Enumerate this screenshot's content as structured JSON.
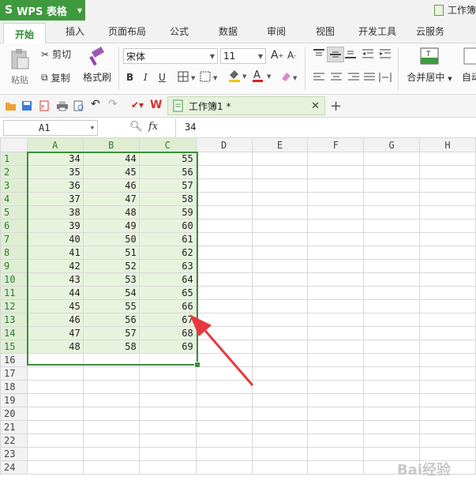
{
  "app": {
    "logo_letter": "S",
    "name": "WPS 表格",
    "doc_title": "工作簿"
  },
  "tabs": [
    "开始",
    "插入",
    "页面布局",
    "公式",
    "数据",
    "审阅",
    "视图",
    "开发工具",
    "云服务"
  ],
  "ribbon": {
    "paste": "粘贴",
    "cut": "剪切",
    "copy": "复制",
    "format_painter": "格式刷",
    "font_name": "宋体",
    "font_size": "11",
    "merge_center": "合并居中",
    "auto_wrap": "自动"
  },
  "document_tab": {
    "name": "工作簿1 *"
  },
  "formula_bar": {
    "cell_ref": "A1",
    "fx": "fx",
    "value": "34"
  },
  "sheet": {
    "columns": [
      "A",
      "B",
      "C",
      "D",
      "E",
      "F",
      "G",
      "H"
    ],
    "rows": [
      {
        "n": "1",
        "a": "34",
        "b": "44",
        "c": "55"
      },
      {
        "n": "2",
        "a": "35",
        "b": "45",
        "c": "56"
      },
      {
        "n": "3",
        "a": "36",
        "b": "46",
        "c": "57"
      },
      {
        "n": "4",
        "a": "37",
        "b": "47",
        "c": "58"
      },
      {
        "n": "5",
        "a": "38",
        "b": "48",
        "c": "59"
      },
      {
        "n": "6",
        "a": "39",
        "b": "49",
        "c": "60"
      },
      {
        "n": "7",
        "a": "40",
        "b": "50",
        "c": "61"
      },
      {
        "n": "8",
        "a": "41",
        "b": "51",
        "c": "62"
      },
      {
        "n": "9",
        "a": "42",
        "b": "52",
        "c": "63"
      },
      {
        "n": "10",
        "a": "43",
        "b": "53",
        "c": "64"
      },
      {
        "n": "11",
        "a": "44",
        "b": "54",
        "c": "65"
      },
      {
        "n": "12",
        "a": "45",
        "b": "55",
        "c": "66"
      },
      {
        "n": "13",
        "a": "46",
        "b": "56",
        "c": "67"
      },
      {
        "n": "14",
        "a": "47",
        "b": "57",
        "c": "68"
      },
      {
        "n": "15",
        "a": "48",
        "b": "58",
        "c": "69"
      },
      {
        "n": "16",
        "a": "",
        "b": "",
        "c": ""
      },
      {
        "n": "17",
        "a": "",
        "b": "",
        "c": ""
      },
      {
        "n": "18",
        "a": "",
        "b": "",
        "c": ""
      },
      {
        "n": "19",
        "a": "",
        "b": "",
        "c": ""
      },
      {
        "n": "20",
        "a": "",
        "b": "",
        "c": ""
      },
      {
        "n": "21",
        "a": "",
        "b": "",
        "c": ""
      },
      {
        "n": "22",
        "a": "",
        "b": "",
        "c": ""
      },
      {
        "n": "23",
        "a": "",
        "b": "",
        "c": ""
      },
      {
        "n": "24",
        "a": "",
        "b": "",
        "c": ""
      }
    ]
  },
  "watermark": "Bai经验",
  "colors": {
    "brand_green": "#3f9a3f",
    "selection_fill": "#e8f3de",
    "arrow_red": "#e8383d"
  }
}
